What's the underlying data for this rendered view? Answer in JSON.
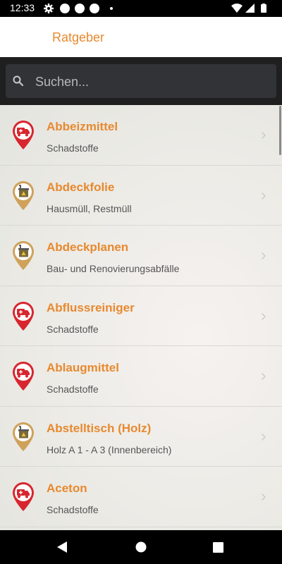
{
  "status": {
    "time": "12:33"
  },
  "header": {
    "title": "Ratgeber"
  },
  "search": {
    "placeholder": "Suchen..."
  },
  "items": [
    {
      "name": "Abbeizmittel",
      "category": "Schadstoffe",
      "icon": "hazardous-waste-truck-pin-icon",
      "color": "#d7262f"
    },
    {
      "name": "Abdeckfolie",
      "category": "Hausmüll, Restmüll",
      "icon": "waste-bin-pin-icon",
      "color": "#cfa15a"
    },
    {
      "name": "Abdeckplanen",
      "category": "Bau- und Renovierungsabfälle",
      "icon": "waste-bin-pin-icon",
      "color": "#cfa15a"
    },
    {
      "name": "Abflussreiniger",
      "category": "Schadstoffe",
      "icon": "hazardous-waste-truck-pin-icon",
      "color": "#d7262f"
    },
    {
      "name": "Ablaugmittel",
      "category": "Schadstoffe",
      "icon": "hazardous-waste-truck-pin-icon",
      "color": "#d7262f"
    },
    {
      "name": "Abstelltisch (Holz)",
      "category": "Holz A 1 - A 3 (Innenbereich)",
      "icon": "waste-bin-pin-icon",
      "color": "#cfa15a"
    },
    {
      "name": "Aceton",
      "category": "Schadstoffe",
      "icon": "hazardous-waste-truck-pin-icon",
      "color": "#d7262f"
    }
  ],
  "colors": {
    "accent": "#e8892f",
    "hazard_red": "#d7262f",
    "bin_gold": "#cfa15a"
  }
}
